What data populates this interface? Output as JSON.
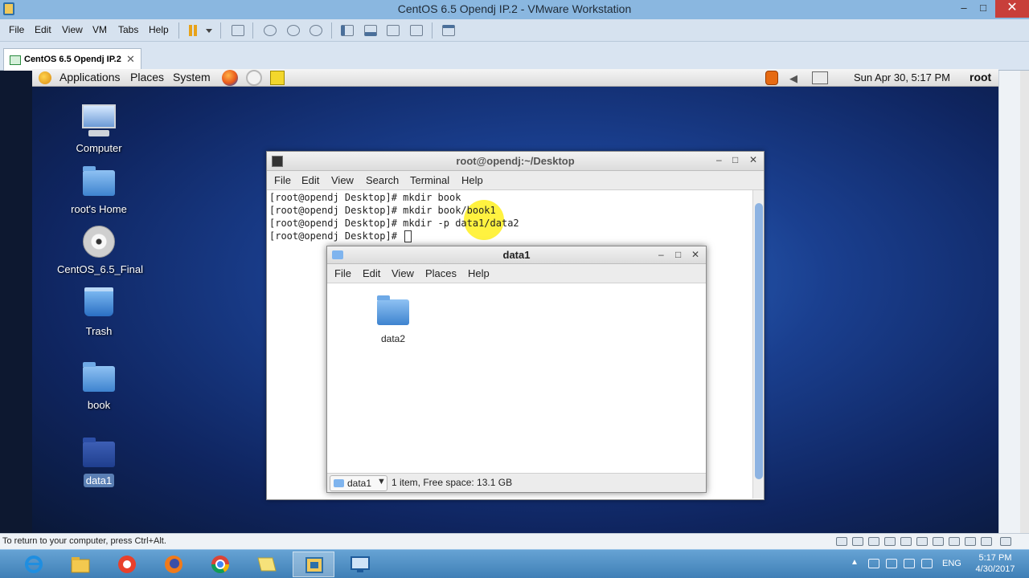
{
  "host": {
    "title": "CentOS 6.5 Opendj IP.2 - VMware Workstation",
    "window_controls": {
      "minimize": "–",
      "maximize": "□",
      "close": "✕"
    },
    "menu": [
      "File",
      "Edit",
      "View",
      "VM",
      "Tabs",
      "Help"
    ],
    "toolbar_icons": [
      "pause-icon",
      "dropdown-icon",
      "send-keys-icon",
      "snapshot-icon",
      "revert-snapshot-icon",
      "snapshot-manager-icon",
      "sidebar-icon",
      "console-view-icon",
      "fullscreen-icon",
      "unity-icon",
      "library-icon"
    ],
    "tab": {
      "label": "CentOS 6.5 Opendj IP.2",
      "close": "✕"
    },
    "status_text": "To return to your computer, press Ctrl+Alt."
  },
  "guest": {
    "panel": {
      "menus": [
        "Applications",
        "Places",
        "System"
      ],
      "datetime": "Sun Apr 30,  5:17 PM",
      "user": "root"
    },
    "desktop_icons": [
      {
        "label": "Computer",
        "icon": "computer-icon"
      },
      {
        "label": "root's Home",
        "icon": "home-folder-icon"
      },
      {
        "label": "CentOS_6.5_Final",
        "icon": "dvd-icon"
      },
      {
        "label": "Trash",
        "icon": "trash-icon"
      },
      {
        "label": "book",
        "icon": "folder-icon"
      },
      {
        "label": "data1",
        "icon": "folder-icon",
        "selected": true
      }
    ],
    "terminal": {
      "title": "root@opendj:~/Desktop",
      "menu": [
        "File",
        "Edit",
        "View",
        "Search",
        "Terminal",
        "Help"
      ],
      "lines": [
        "[root@opendj Desktop]# mkdir book",
        "[root@opendj Desktop]# mkdir book/book1",
        "[root@opendj Desktop]# mkdir -p data1/data2",
        "[root@opendj Desktop]# "
      ]
    },
    "file_manager": {
      "title": "data1",
      "menu": [
        "File",
        "Edit",
        "View",
        "Places",
        "Help"
      ],
      "items": [
        {
          "label": "data2",
          "icon": "folder-icon"
        }
      ],
      "location": "data1",
      "status": "1 item, Free space: 13.1 GB"
    }
  },
  "taskbar": {
    "apps": [
      "internet-explorer-icon",
      "file-explorer-icon",
      "screen-recorder-icon",
      "firefox-icon",
      "chrome-icon",
      "sticky-folder-icon",
      "vmware-icon",
      "remote-desktop-icon"
    ],
    "active_app": "vmware-icon",
    "language": "ENG",
    "time": "5:17 PM",
    "date": "4/30/2017"
  }
}
